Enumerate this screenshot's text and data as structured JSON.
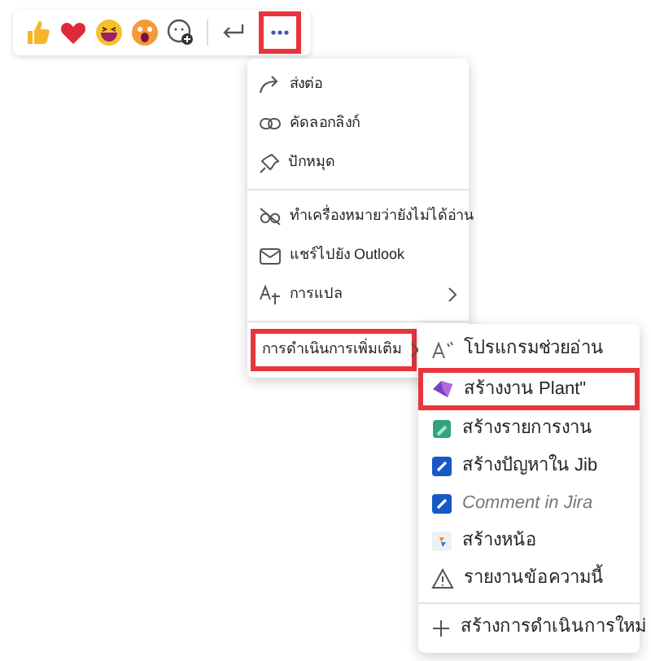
{
  "toolbar": {
    "more_button": {
      "highlighted": true
    }
  },
  "menu": {
    "sections": [
      [
        {
          "label": "ส่งต่อ",
          "has_submenu": false
        },
        {
          "label": "คัดลอกลิงก์",
          "has_submenu": false
        },
        {
          "label": "ปักหมุด",
          "has_submenu": false
        }
      ],
      [
        {
          "label": "ทำเครื่องหมายว่ายังไม่ได้อ่าน",
          "has_submenu": false
        },
        {
          "label": "แชร์ไปยัง Outlook",
          "has_submenu": false
        },
        {
          "label": "การแปล",
          "has_submenu": true
        }
      ],
      [
        {
          "label": "การดำเนินการเพิ่มเติม",
          "has_submenu": true,
          "highlighted": true
        }
      ]
    ]
  },
  "submenu": {
    "sections": [
      [
        {
          "label": "โปรแกรมช่วยอ่าน",
          "highlighted": false,
          "disabled": false
        },
        {
          "label": "สร้างงาน Plant\"",
          "highlighted": true,
          "disabled": false
        },
        {
          "label": "สร้างรายการงาน",
          "highlighted": false,
          "disabled": false
        },
        {
          "label": "สร้างปัญหาใน Jib",
          "highlighted": false,
          "disabled": false
        },
        {
          "label": "Comment in Jira",
          "highlighted": false,
          "disabled": true
        },
        {
          "label": "สร้างหน้อ",
          "highlighted": false,
          "disabled": false
        },
        {
          "label": "รายงานข้อความนี้",
          "highlighted": false,
          "disabled": false
        }
      ],
      [
        {
          "label": "สร้างการดำเนินการใหม่",
          "highlighted": false,
          "disabled": false
        }
      ]
    ]
  }
}
